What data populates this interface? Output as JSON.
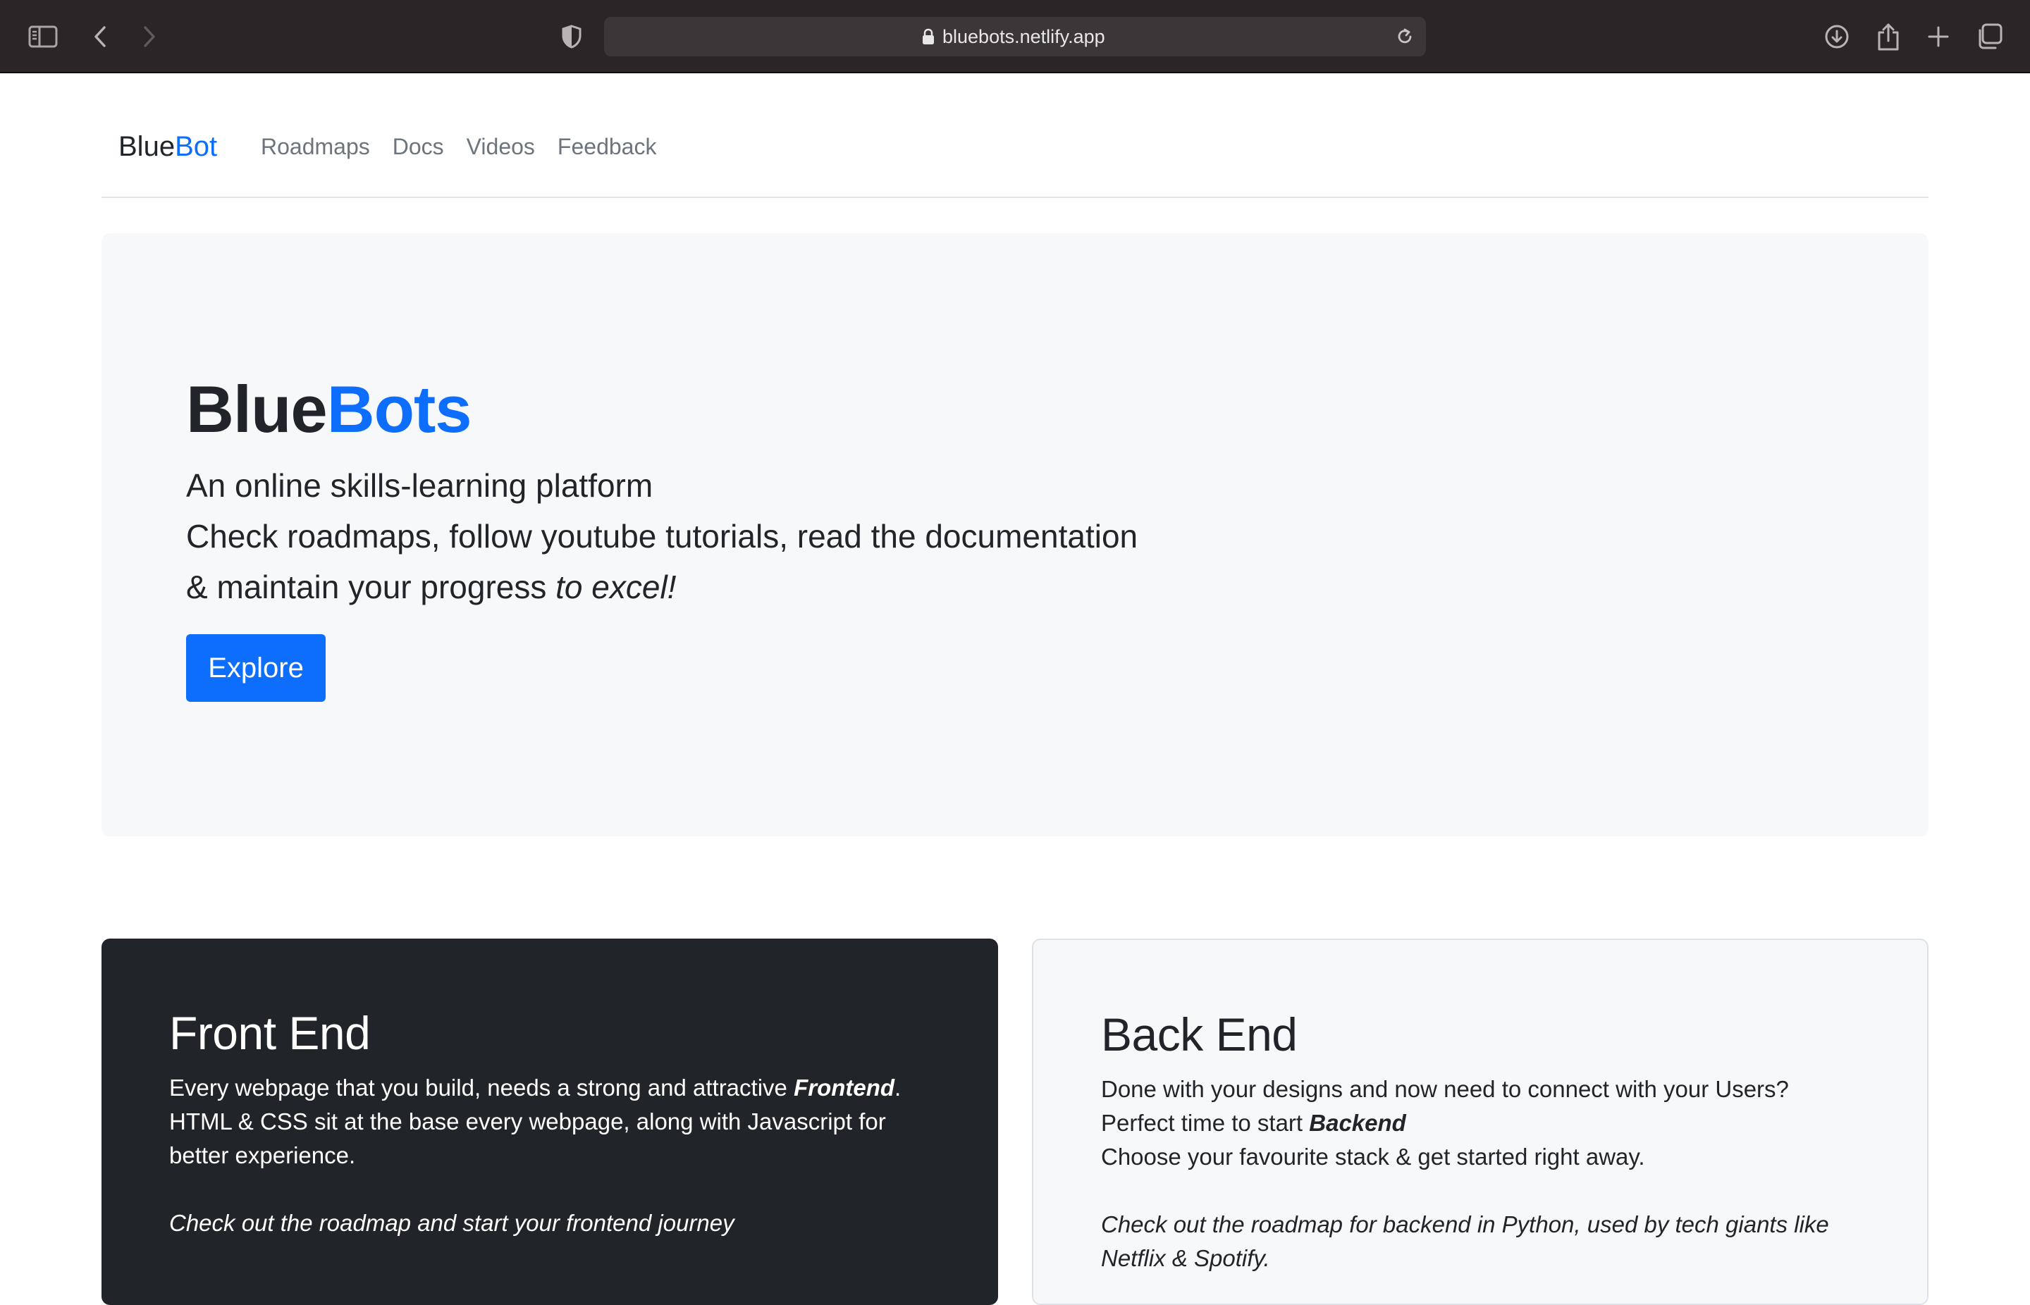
{
  "browser": {
    "url": "bluebots.netlify.app"
  },
  "navbar": {
    "brand_primary": "Blue",
    "brand_accent": "Bot",
    "links": [
      "Roadmaps",
      "Docs",
      "Videos",
      "Feedback"
    ]
  },
  "hero": {
    "title_primary": "Blue",
    "title_accent": "Bots",
    "lead_line1": "An online skills-learning platform",
    "lead_line2": "Check roadmaps, follow youtube tutorials, read the documentation",
    "lead_line3_prefix": "& maintain your progress ",
    "lead_line3_emphasis": "to excel!",
    "explore_label": "Explore"
  },
  "frontend_card": {
    "title": "Front End",
    "line1_prefix": "Every webpage that you build, needs a strong and attractive ",
    "line1_emphasis": "Frontend",
    "line1_suffix": ".",
    "line2": "HTML & CSS sit at the base every webpage, along with Javascript for",
    "line3": "better experience.",
    "cta": "Check out the roadmap and start your frontend journey"
  },
  "backend_card": {
    "title": "Back End",
    "line1": "Done with your designs and now need to connect with your Users?",
    "line2_prefix": "Perfect time to start ",
    "line2_emphasis": "Backend",
    "line3": "Choose your favourite stack & get started right away.",
    "cta_line1": "Check out the roadmap for backend in Python, used by tech giants like",
    "cta_line2": "Netflix & Spotify."
  },
  "colors": {
    "accent": "#0d6efd",
    "dark_card": "#212529",
    "hero_bg": "#f7f8fa",
    "chrome_bg": "#2a2527"
  }
}
